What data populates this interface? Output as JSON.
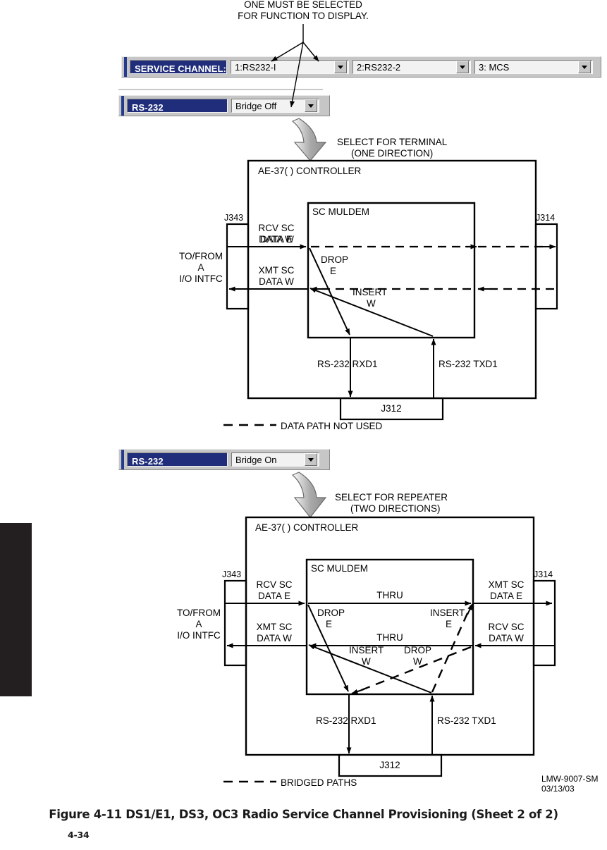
{
  "callout": {
    "line1": "ONE MUST BE SELECTED",
    "line2": "FOR FUNCTION TO DISPLAY."
  },
  "service_channel_bar": {
    "label": "SERVICE CHANNEL:",
    "channels": [
      {
        "name": "channel-1",
        "value": "1:RS232-I"
      },
      {
        "name": "channel-2",
        "value": "2:RS232-2"
      },
      {
        "name": "channel-3",
        "value": "3: MCS"
      }
    ],
    "dropdown_icon": "chevron-down-icon"
  },
  "rs232_bars": [
    {
      "label": "RS-232",
      "value": "Bridge Off"
    },
    {
      "label": "RS-232",
      "value": "Bridge On"
    }
  ],
  "diagram_top": {
    "select_note_line1": "SELECT FOR TERMINAL",
    "select_note_line2": "(ONE DIRECTION)",
    "controller_title": "AE-37( ) CONTROLLER",
    "muldem_title": "SC MULDEM",
    "connector_left": "J343",
    "connector_right": "J314",
    "connector_bottom": "J312",
    "io_label_line1": "TO/FROM",
    "io_label_line2": "A",
    "io_label_line3": "I/O INTFC",
    "left_upper_line1": "RCV SC",
    "left_upper_line2": "DATA E",
    "left_lower_line1": "XMT SC",
    "left_lower_line2": "DATA W",
    "drop_line1": "DROP",
    "drop_line2": "E",
    "insert_line1": "INSERT",
    "insert_line2": "W",
    "rxd_label": "RS-232 RXD1",
    "txd_label": "RS-232 TXD1",
    "legend": "DATA  PATH NOT USED"
  },
  "diagram_bottom": {
    "select_note_line1": "SELECT FOR REPEATER",
    "select_note_line2": "(TWO DIRECTIONS)",
    "controller_title": "AE-37( ) CONTROLLER",
    "muldem_title": "SC MULDEM",
    "connector_left": "J343",
    "connector_right": "J314",
    "connector_bottom": "J312",
    "io_label_line1": "TO/FROM",
    "io_label_line2": "A",
    "io_label_line3": "I/O INTFC",
    "left_upper_line1": "RCV SC",
    "left_upper_line2": "DATA E",
    "left_lower_line1": "XMT SC",
    "left_lower_line2": "DATA W",
    "right_upper_line1": "XMT SC",
    "right_upper_line2": "DATA E",
    "right_lower_line1": "RCV SC",
    "right_lower_line2": "DATA W",
    "thru_upper": "THRU",
    "thru_lower": "THRU",
    "drop_e_line1": "DROP",
    "drop_e_line2": "E",
    "insert_e_line1": "INSERT",
    "insert_e_line2": "E",
    "insert_w_line1": "INSERT",
    "insert_w_line2": "W",
    "drop_w_line1": "DROP",
    "drop_w_line2": "W",
    "rxd_label": "RS-232 RXD1",
    "txd_label": "RS-232 TXD1",
    "legend": "BRIDGED PATHS"
  },
  "footer": {
    "doc_id": "LMW-9007-SM",
    "doc_date": "03/13/03",
    "caption": "Figure 4-11  DS1/E1, DS3, OC3 Radio Service Channel Provisioning (Sheet 2 of 2)",
    "page_number": "4-34"
  }
}
